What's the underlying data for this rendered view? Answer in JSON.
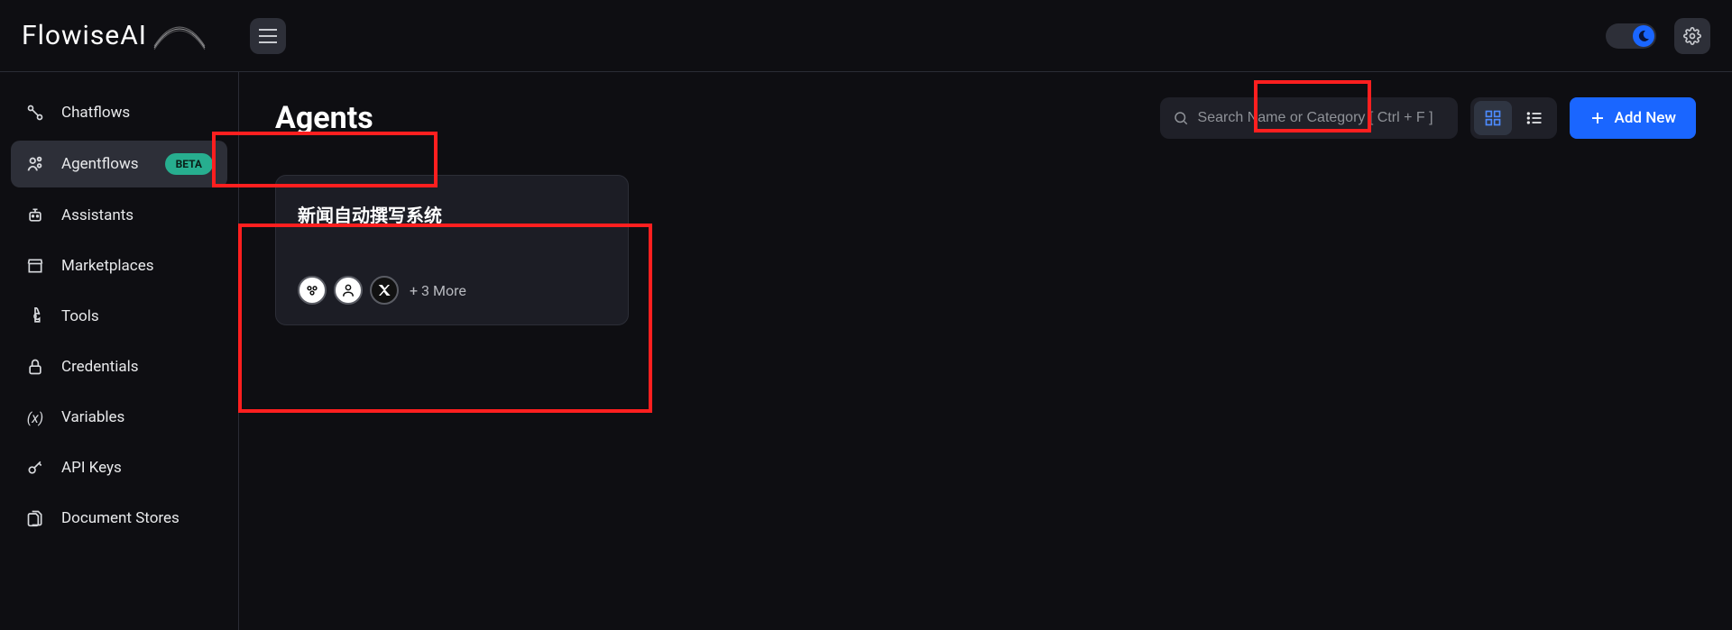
{
  "brand": "FlowiseAI",
  "sidebar": {
    "items": [
      {
        "label": "Chatflows"
      },
      {
        "label": "Agentflows",
        "badge": "BETA"
      },
      {
        "label": "Assistants"
      },
      {
        "label": "Marketplaces"
      },
      {
        "label": "Tools"
      },
      {
        "label": "Credentials"
      },
      {
        "label": "Variables"
      },
      {
        "label": "API Keys"
      },
      {
        "label": "Document Stores"
      }
    ]
  },
  "page": {
    "title": "Agents",
    "search_placeholder": "Search Name or Category [ Ctrl + F ]",
    "add_button_label": "Add New"
  },
  "agents": [
    {
      "title": "新闻自动撰写系统",
      "more_label": "+ 3 More"
    }
  ]
}
